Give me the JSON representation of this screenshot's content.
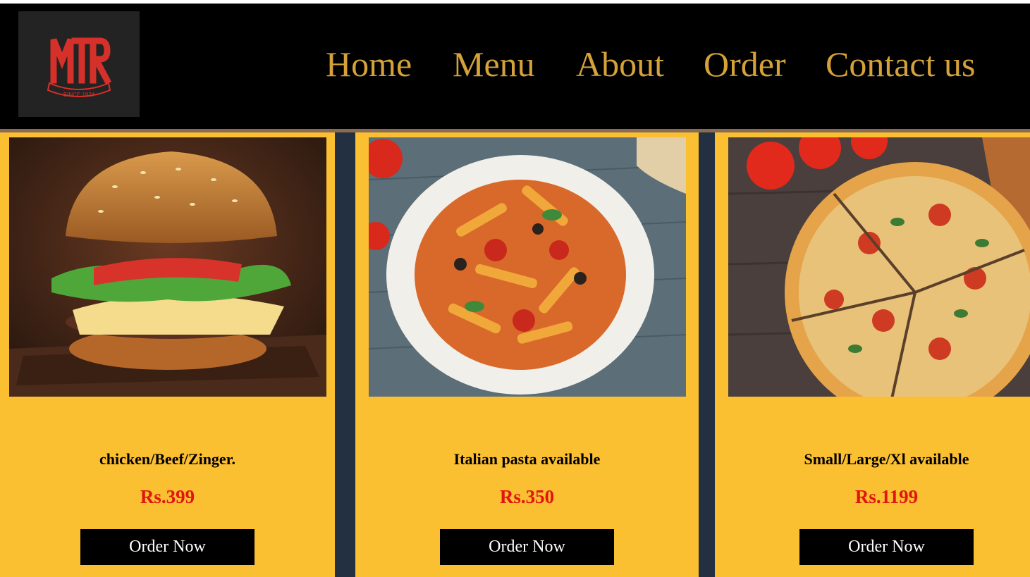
{
  "brand": {
    "logo_text": "MTR",
    "logo_tagline": "SINCE 1924",
    "logo_color": "#d6302a"
  },
  "nav": {
    "items": [
      {
        "label": "Home"
      },
      {
        "label": "Menu"
      },
      {
        "label": "About"
      },
      {
        "label": "Order"
      },
      {
        "label": "Contact us"
      }
    ],
    "color": "#d5a23a"
  },
  "cards": [
    {
      "image": "burger-photo",
      "description": "chicken/Beef/Zinger.",
      "price": "Rs.399",
      "button": "Order Now"
    },
    {
      "image": "pasta-photo",
      "description": "Italian pasta available",
      "price": "Rs.350",
      "button": "Order Now"
    },
    {
      "image": "pizza-photo",
      "description": "Small/Large/Xl available",
      "price": "Rs.1199",
      "button": "Order Now"
    }
  ],
  "colors": {
    "card_background": "#fbbf32",
    "page_background": "#233041",
    "price": "#e0150f",
    "header": "#000000"
  }
}
